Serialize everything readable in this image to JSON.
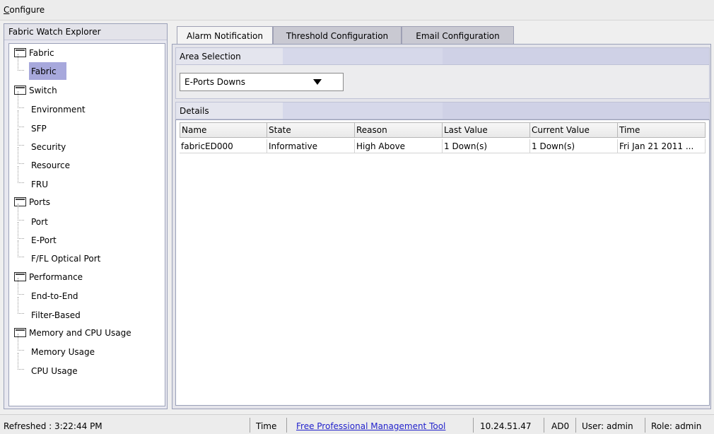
{
  "menubar": {
    "configure_first": "C",
    "configure_rest": "onfigure"
  },
  "explorer": {
    "title": "Fabric Watch Explorer",
    "tree": [
      {
        "type": "folder",
        "label": "Fabric"
      },
      {
        "type": "leaf",
        "label": "Fabric",
        "selected": true
      },
      {
        "type": "folder",
        "label": "Switch"
      },
      {
        "type": "leaf",
        "label": "Environment"
      },
      {
        "type": "leaf",
        "label": "SFP"
      },
      {
        "type": "leaf",
        "label": "Security"
      },
      {
        "type": "leaf",
        "label": "Resource"
      },
      {
        "type": "leaf",
        "label": "FRU"
      },
      {
        "type": "folder",
        "label": "Ports"
      },
      {
        "type": "leaf",
        "label": "Port"
      },
      {
        "type": "leaf",
        "label": "E-Port"
      },
      {
        "type": "leaf",
        "label": "F/FL Optical Port"
      },
      {
        "type": "folder",
        "label": "Performance"
      },
      {
        "type": "leaf",
        "label": "End-to-End"
      },
      {
        "type": "leaf",
        "label": "Filter-Based"
      },
      {
        "type": "folder",
        "label": "Memory and CPU Usage"
      },
      {
        "type": "leaf",
        "label": "Memory Usage"
      },
      {
        "type": "leaf",
        "label": "CPU Usage"
      }
    ]
  },
  "tabs": [
    {
      "label": "Alarm Notification",
      "active": true
    },
    {
      "label": "Threshold Configuration",
      "active": false
    },
    {
      "label": "Email Configuration",
      "active": false
    }
  ],
  "area_selection": {
    "title": "Area Selection",
    "selected": "E-Ports Downs"
  },
  "details": {
    "title": "Details",
    "columns": [
      "Name",
      "State",
      "Reason",
      "Last Value",
      "Current Value",
      "Time"
    ],
    "rows": [
      [
        "fabricED000",
        "Informative",
        "High Above",
        "1 Down(s)",
        "1 Down(s)",
        "Fri Jan 21 2011 ..."
      ]
    ]
  },
  "status": {
    "refreshed": "Refreshed : 3:22:44 PM",
    "time": "Time",
    "link": "Free Professional Management Tool",
    "ip": "10.24.51.47",
    "ad": "AD0",
    "user": "User: admin",
    "role": "Role: admin"
  },
  "colors": {
    "selected_highlight": "#a7a8dc",
    "link": "#2222cc"
  }
}
